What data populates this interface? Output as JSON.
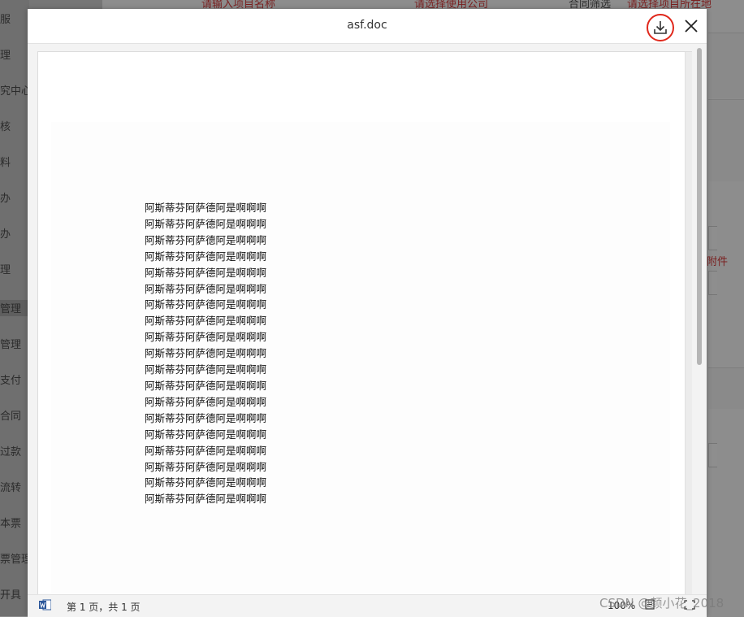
{
  "background": {
    "sidebar_items": [
      "服",
      "理",
      "究中心",
      "核",
      "料",
      "办",
      "办",
      "理",
      "管理",
      "管理",
      "支付",
      "合同",
      "过款",
      "流转",
      "本票",
      "票管理",
      "开具"
    ],
    "active_sidebar_index": 8,
    "top_labels": [
      "请输入项目名称",
      "请选择使用公司",
      "合同筛选",
      "请选择项目所在地"
    ],
    "attachment_label": "附件"
  },
  "modal": {
    "title": "asf.doc",
    "download_icon": "download-icon",
    "close_icon": "close-icon",
    "accent_color": "#e0281c"
  },
  "document": {
    "lines": [
      "阿斯蒂芬阿萨德阿是啊啊啊",
      "阿斯蒂芬阿萨德阿是啊啊啊",
      "阿斯蒂芬阿萨德阿是啊啊啊",
      "阿斯蒂芬阿萨德阿是啊啊啊",
      "阿斯蒂芬阿萨德阿是啊啊啊",
      "阿斯蒂芬阿萨德阿是啊啊啊",
      "阿斯蒂芬阿萨德阿是啊啊啊",
      "阿斯蒂芬阿萨德阿是啊啊啊",
      "阿斯蒂芬阿萨德阿是啊啊啊",
      "阿斯蒂芬阿萨德阿是啊啊啊",
      "阿斯蒂芬阿萨德阿是啊啊啊",
      "阿斯蒂芬阿萨德阿是啊啊啊",
      "阿斯蒂芬阿萨德阿是啊啊啊",
      "阿斯蒂芬阿萨德阿是啊啊啊",
      "阿斯蒂芬阿萨德阿是啊啊啊",
      "阿斯蒂芬阿萨德阿是啊啊啊",
      "阿斯蒂芬阿萨德阿是啊啊啊",
      "阿斯蒂芬阿萨德阿是啊啊啊",
      "阿斯蒂芬阿萨德阿是啊啊啊"
    ]
  },
  "statusbar": {
    "word_icon": "word-document-icon",
    "page_info": "第 1 页，共 1 页",
    "zoom": "100%",
    "view_icon": "reading-view-icon",
    "fit_icon": "fit-page-icon"
  },
  "watermark": "CSDN @颜小花_2018"
}
